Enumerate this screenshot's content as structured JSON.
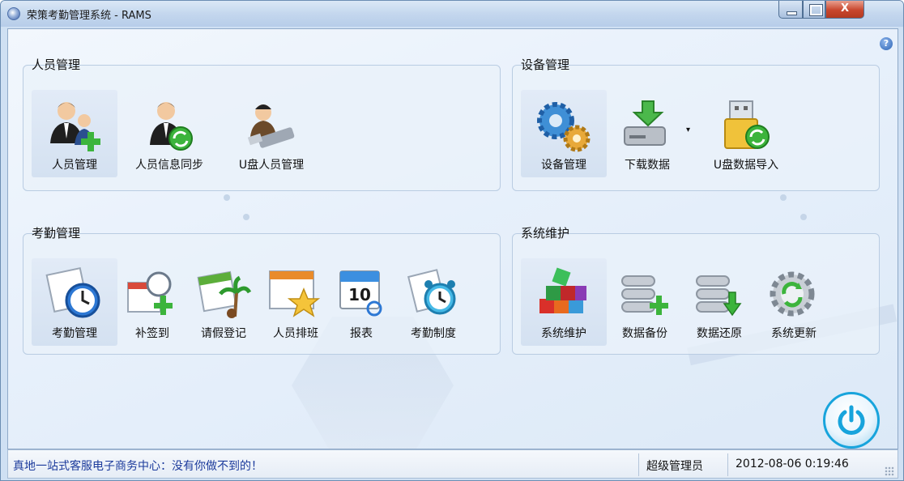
{
  "window": {
    "title": "荣策考勤管理系统 - RAMS",
    "close_label": "X"
  },
  "help": {
    "label": "?"
  },
  "groups": [
    {
      "title": "人员管理",
      "tools": [
        {
          "label": "人员管理",
          "icon": "person-add-icon"
        },
        {
          "label": "人员信息同步",
          "icon": "person-sync-icon"
        },
        {
          "label": "U盘人员管理",
          "icon": "person-usb-icon"
        }
      ]
    },
    {
      "title": "设备管理",
      "tools": [
        {
          "label": "设备管理",
          "icon": "gears-icon"
        },
        {
          "label": "下载数据",
          "icon": "drive-download-icon"
        },
        {
          "label": "U盘数据导入",
          "icon": "usb-import-icon"
        }
      ]
    },
    {
      "title": "考勤管理",
      "tools": [
        {
          "label": "考勤管理",
          "icon": "calendar-clock-icon"
        },
        {
          "label": "补签到",
          "icon": "calendar-add-icon"
        },
        {
          "label": "请假登记",
          "icon": "calendar-palm-icon"
        },
        {
          "label": "人员排班",
          "icon": "schedule-star-icon"
        },
        {
          "label": "报表",
          "icon": "report-calendar-icon"
        },
        {
          "label": "考勤制度",
          "icon": "alarm-clock-icon"
        }
      ]
    },
    {
      "title": "系统维护",
      "tools": [
        {
          "label": "系统维护",
          "icon": "blocks-icon"
        },
        {
          "label": "数据备份",
          "icon": "database-add-icon"
        },
        {
          "label": "数据还原",
          "icon": "database-restore-icon"
        },
        {
          "label": "系统更新",
          "icon": "gear-refresh-icon"
        }
      ]
    }
  ],
  "status": {
    "message": "真地一站式客服电子商务中心：没有你做不到的！",
    "user": "超级管理员",
    "datetime": "2012-08-06 0:19:46"
  },
  "colors": {
    "accent": "#18a4dc",
    "status_text": "#1c3b9c"
  }
}
